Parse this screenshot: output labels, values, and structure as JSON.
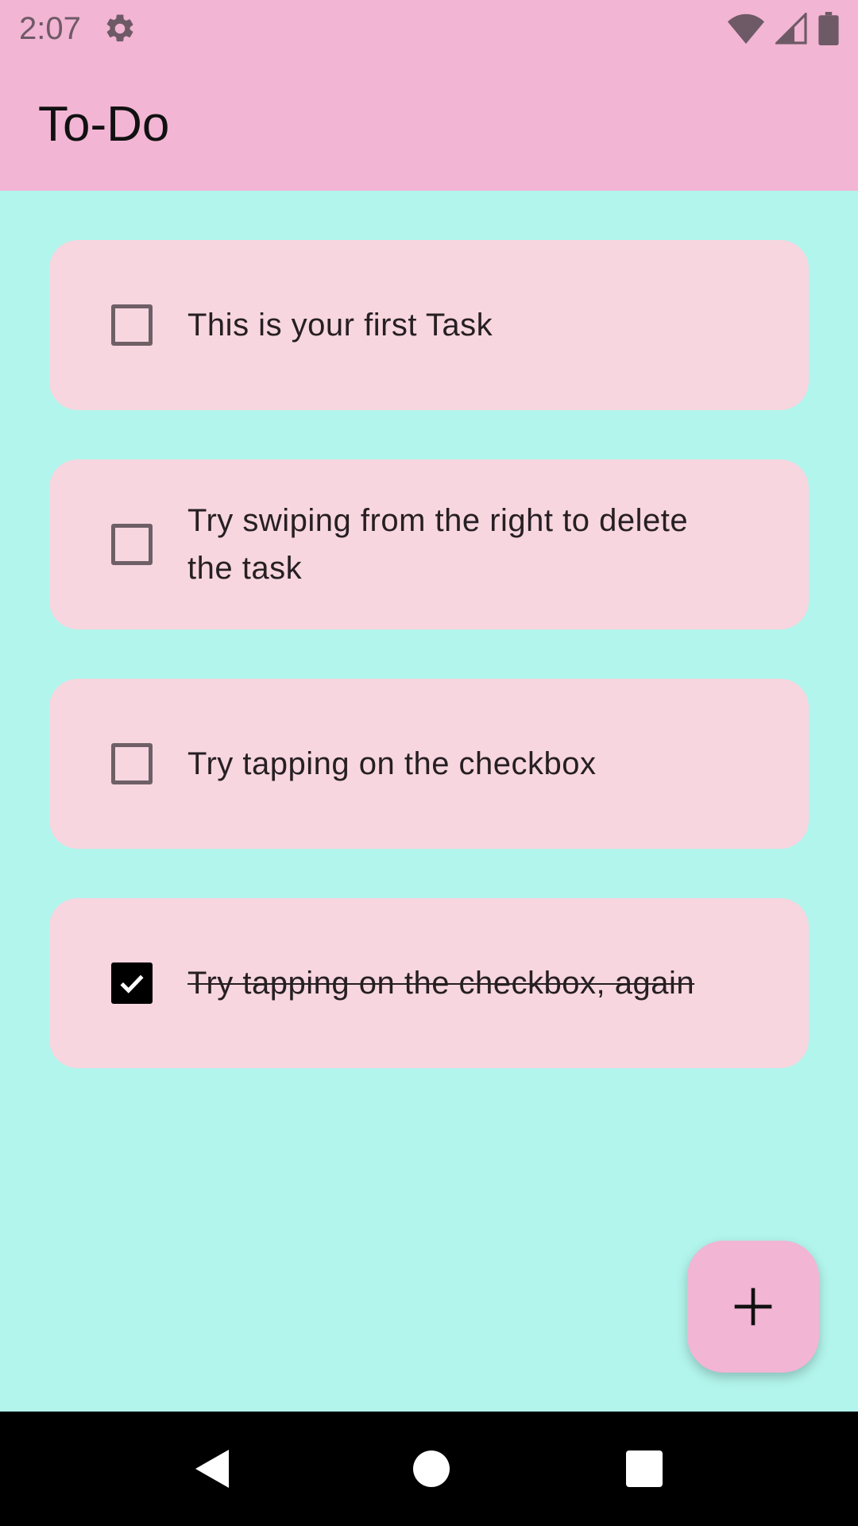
{
  "status_bar": {
    "time": "2:07",
    "icons": [
      "gear-icon",
      "wifi-icon",
      "signal-icon",
      "battery-icon"
    ]
  },
  "app_bar": {
    "title": "To-Do"
  },
  "tasks": [
    {
      "text": "This is your first Task",
      "checked": false
    },
    {
      "text": "Try swiping from the right to delete the task",
      "checked": false
    },
    {
      "text": "Try tapping on the checkbox",
      "checked": false
    },
    {
      "text": "Try tapping on the checkbox, again",
      "checked": true
    }
  ],
  "fab": {
    "icon": "plus-icon"
  },
  "nav_bar": {
    "icons": [
      "back-icon",
      "home-icon",
      "recents-icon"
    ]
  },
  "colors": {
    "app_bar": "#f2b5d4",
    "background": "#b2f5ec",
    "card": "#f7d6df",
    "fab": "#f2b5d4"
  }
}
